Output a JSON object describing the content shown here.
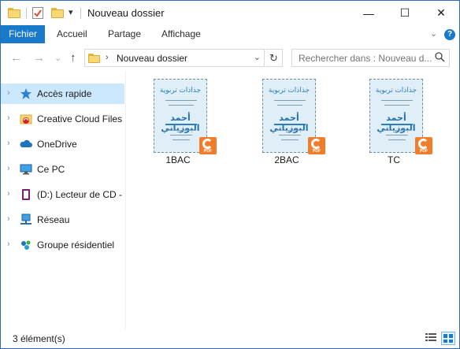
{
  "window": {
    "title": "Nouveau dossier",
    "minimize_symbol": "—",
    "maximize_symbol": "☐",
    "close_symbol": "✕",
    "accent_color": "#1979ca"
  },
  "quick_access_toolbar": {
    "dropdown_symbol": "▾"
  },
  "ribbon": {
    "tabs": [
      "Fichier",
      "Accueil",
      "Partage",
      "Affichage"
    ],
    "expand_symbol": "⌄",
    "help_symbol": "?"
  },
  "address_bar": {
    "back_symbol": "←",
    "forward_symbol": "→",
    "recent_symbol": "⌄",
    "up_symbol": "↑",
    "breadcrumb_separator": "›",
    "path": "Nouveau dossier",
    "dropdown_symbol": "⌄",
    "refresh_symbol": "↻"
  },
  "search": {
    "placeholder": "Rechercher dans : Nouveau d..."
  },
  "sidebar": {
    "items": [
      {
        "label": "Accès rapide",
        "icon": "star-icon",
        "selected": true
      },
      {
        "label": "Creative Cloud Files",
        "icon": "creative-cloud-icon",
        "selected": false
      },
      {
        "label": "OneDrive",
        "icon": "cloud-icon",
        "selected": false
      },
      {
        "label": "Ce PC",
        "icon": "computer-icon",
        "selected": false
      },
      {
        "label": "(D:) Lecteur de CD - M",
        "icon": "cd-drive-icon",
        "selected": false
      },
      {
        "label": "Réseau",
        "icon": "network-icon",
        "selected": false
      },
      {
        "label": "Groupe résidentiel",
        "icon": "homegroup-icon",
        "selected": false
      }
    ],
    "expand_symbol": "›"
  },
  "files": [
    {
      "name": "1BAC",
      "type": "pdf",
      "thumb_title": "جذاذات تربوية",
      "thumb_author": "أحمد البوزياني"
    },
    {
      "name": "2BAC",
      "type": "pdf",
      "thumb_title": "جذاذات تربوية",
      "thumb_author": "أحمد البوزياني"
    },
    {
      "name": "TC",
      "type": "pdf",
      "thumb_title": "جذاذات تربوية",
      "thumb_author": "أحمد البوزياني"
    }
  ],
  "pdf_badge_label": "PDF",
  "status": {
    "count_text": "3 élément(s)"
  }
}
